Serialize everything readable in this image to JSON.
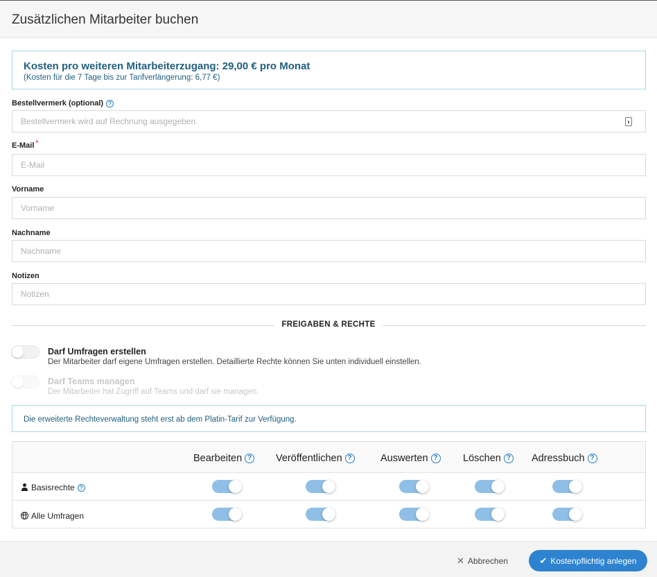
{
  "dialog": {
    "title": "Zusätzlichen Mitarbeiter buchen"
  },
  "cost": {
    "main": "Kosten pro weiteren Mitarbeiterzugang: 29,00 € pro Monat",
    "sub": "(Kosten für die 7 Tage bis zur Tarifverlängerung: 6,77 €)"
  },
  "form": {
    "order_note": {
      "label": "Bestellvermerk (optional)",
      "placeholder": "Bestellvermerk wird auf Rechnung ausgegeben"
    },
    "email": {
      "label": "E-Mail",
      "required_mark": "*",
      "placeholder": "E-Mail"
    },
    "firstname": {
      "label": "Vorname",
      "placeholder": "Vorname"
    },
    "lastname": {
      "label": "Nachname",
      "placeholder": "Nachname"
    },
    "notes": {
      "label": "Notizen",
      "placeholder": "Notizen"
    }
  },
  "section": {
    "title": "FREIGABEN & RECHTE"
  },
  "permissions": [
    {
      "title": "Darf Umfragen erstellen",
      "desc": "Der Mitarbeiter darf eigene Umfragen erstellen. Detaillierte Rechte können Sie unten individuell einstellen.",
      "enabled": false,
      "disabled": false
    },
    {
      "title": "Darf Teams managen",
      "desc": "Der Mitarbeiter hat Zugriff auf Teams und darf sie managen.",
      "enabled": false,
      "disabled": true
    }
  ],
  "info": {
    "text": "Die erweiterte Rechteverwaltung steht erst ab dem Platin-Tarif zur Verfügung."
  },
  "table": {
    "columns": [
      "Bearbeiten",
      "Veröffentlichen",
      "Auswerten",
      "Löschen",
      "Adressbuch"
    ],
    "rows": [
      {
        "label": "Basisrechte",
        "icon": "user-icon",
        "values": [
          true,
          true,
          true,
          true,
          true
        ]
      },
      {
        "label": "Alle Umfragen",
        "icon": "globe-icon",
        "values": [
          true,
          true,
          true,
          true,
          true
        ]
      }
    ]
  },
  "footer": {
    "cancel": "Abbrechen",
    "submit": "Kostenpflichtig anlegen"
  },
  "colors": {
    "accent": "#2d83cf",
    "info_text": "#205f80",
    "toggle_on": "#8fbfe6"
  }
}
